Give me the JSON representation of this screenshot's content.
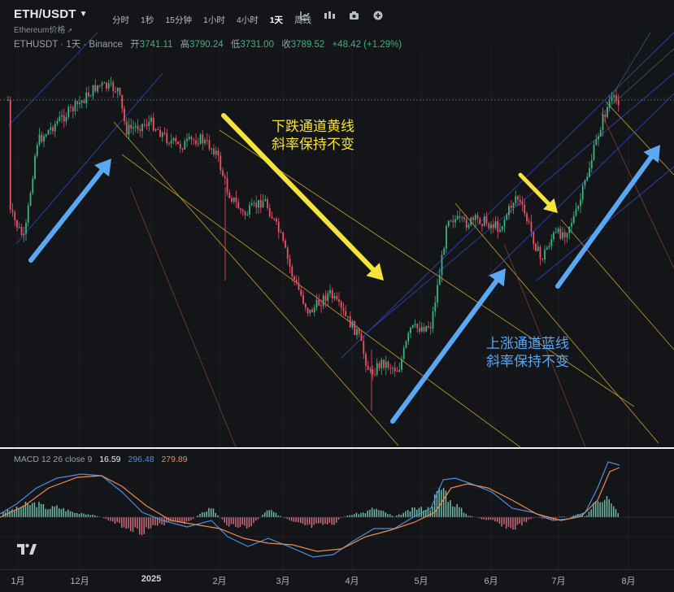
{
  "header": {
    "symbol": "ETH/USDT",
    "subtitle": "Ethereum价格",
    "intervals": [
      "分时",
      "1秒",
      "15分钟",
      "1小时",
      "4小时",
      "1天",
      "周线"
    ],
    "active_interval": "1天",
    "tool_icons": [
      "candle-type-icon",
      "indicators-icon",
      "camera-icon",
      "add-icon"
    ]
  },
  "legend": {
    "title": "ETHUSDT · 1天 · Binance",
    "open_label": "开",
    "open": "3741.11",
    "high_label": "高",
    "high": "3790.24",
    "low_label": "低",
    "low": "3731.00",
    "close_label": "收",
    "close": "3789.52",
    "change": "+48.42 (+1.29%)"
  },
  "macd_legend": {
    "name": "MACD 12 26 close 9",
    "histogram": "16.59",
    "macd": "296.48",
    "signal": "279.89"
  },
  "annotations": {
    "down_channel": [
      "下跌通道黄线",
      "斜率保持不变"
    ],
    "up_channel": [
      "上涨通道蓝线",
      "斜率保持不变"
    ]
  },
  "x_axis": {
    "labels": [
      "1月",
      "12月",
      "2025",
      "2月",
      "3月",
      "4月",
      "5月",
      "6月",
      "7月",
      "8月"
    ]
  },
  "colors": {
    "background": "#131519",
    "bull": "#3fb283",
    "bear": "#ef5064",
    "channel_yellow": "#d8a52c",
    "channel_blue": "#3a46c8",
    "arrow_blue": "#5aa8f3",
    "arrow_yellow": "#f5e23a",
    "macd_line": "#4a90e2",
    "signal_line": "#f08a4b"
  },
  "chart_data": {
    "type": "candlestick",
    "symbol": "ETHUSDT",
    "interval": "1天",
    "x_labels": [
      "1月",
      "12月",
      "2025",
      "2月",
      "3月",
      "4月",
      "5月",
      "6月",
      "7月",
      "8月"
    ],
    "approx_close_path": [
      {
        "x": "12月",
        "close": 3700
      },
      {
        "x": "2025",
        "close": 3350
      },
      {
        "x": "2月",
        "close": 2700
      },
      {
        "x": "3月",
        "close": 2200
      },
      {
        "x": "4月",
        "close": 1800
      },
      {
        "x": "5月",
        "close": 1850
      },
      {
        "x": "6月",
        "close": 2600
      },
      {
        "x": "7月",
        "close": 2500
      },
      {
        "x": "8月",
        "close": 3789.52
      }
    ],
    "last": {
      "open": 3741.11,
      "high": 3790.24,
      "low": 3731.0,
      "close": 3789.52
    }
  }
}
